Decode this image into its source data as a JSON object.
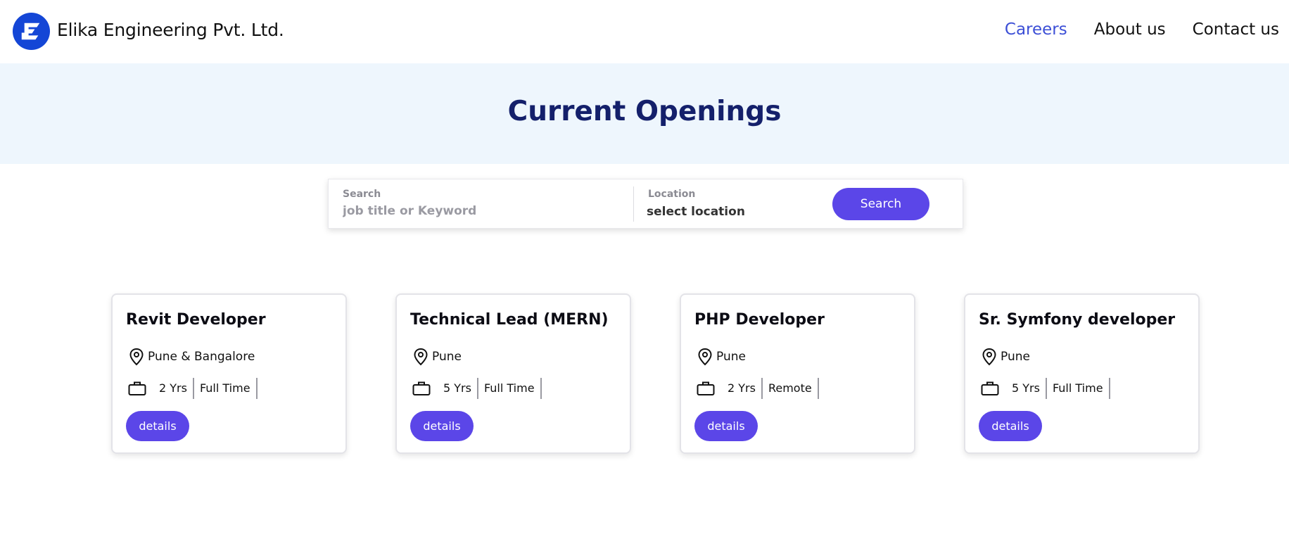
{
  "header": {
    "brand": "Elika Engineering Pvt. Ltd.",
    "nav": [
      {
        "label": "Careers",
        "active": true
      },
      {
        "label": "About us",
        "active": false
      },
      {
        "label": "Contact us",
        "active": false
      }
    ]
  },
  "hero": {
    "title": "Current Openings"
  },
  "search": {
    "search_label": "Search",
    "search_placeholder": "job title or Keyword",
    "location_label": "Location",
    "location_value": "select location",
    "button_label": "Search"
  },
  "jobs": [
    {
      "title": "Revit Developer",
      "location": "Pune & Bangalore",
      "experience": "2 Yrs",
      "type": "Full Time",
      "button": "details"
    },
    {
      "title": "Technical Lead (MERN)",
      "location": "Pune",
      "experience": "5 Yrs",
      "type": "Full Time",
      "button": "details"
    },
    {
      "title": "PHP Developer",
      "location": "Pune",
      "experience": "2 Yrs",
      "type": "Remote",
      "button": "details"
    },
    {
      "title": "Sr. Symfony developer",
      "location": "Pune",
      "experience": "5 Yrs",
      "type": "Full Time",
      "button": "details"
    }
  ],
  "colors": {
    "accent": "#5b46e8",
    "nav_active": "#3c4fd6",
    "hero_bg": "#eef6fd",
    "title": "#14206b"
  },
  "icons": {
    "logo": "elika-e-logo",
    "location": "map-pin-icon",
    "experience": "briefcase-icon"
  }
}
